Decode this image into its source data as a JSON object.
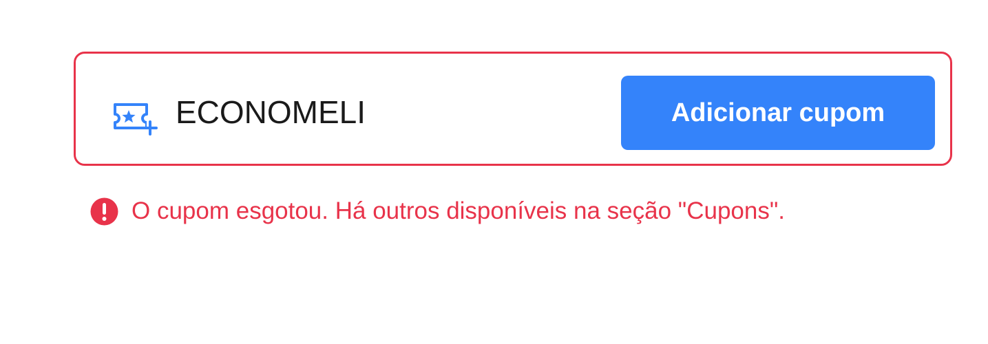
{
  "coupon": {
    "icon": "coupon-ticket-add-icon",
    "input_value": "ECONOMELI",
    "button_label": "Adicionar cupom"
  },
  "error": {
    "icon": "exclamation-circle-icon",
    "message": "O cupom esgotou. Há outros disponíveis na seção \"Cupons\"."
  },
  "colors": {
    "error": "#e8334a",
    "accent": "#3483fa",
    "text": "#1a1a1a",
    "background": "#ffffff"
  }
}
